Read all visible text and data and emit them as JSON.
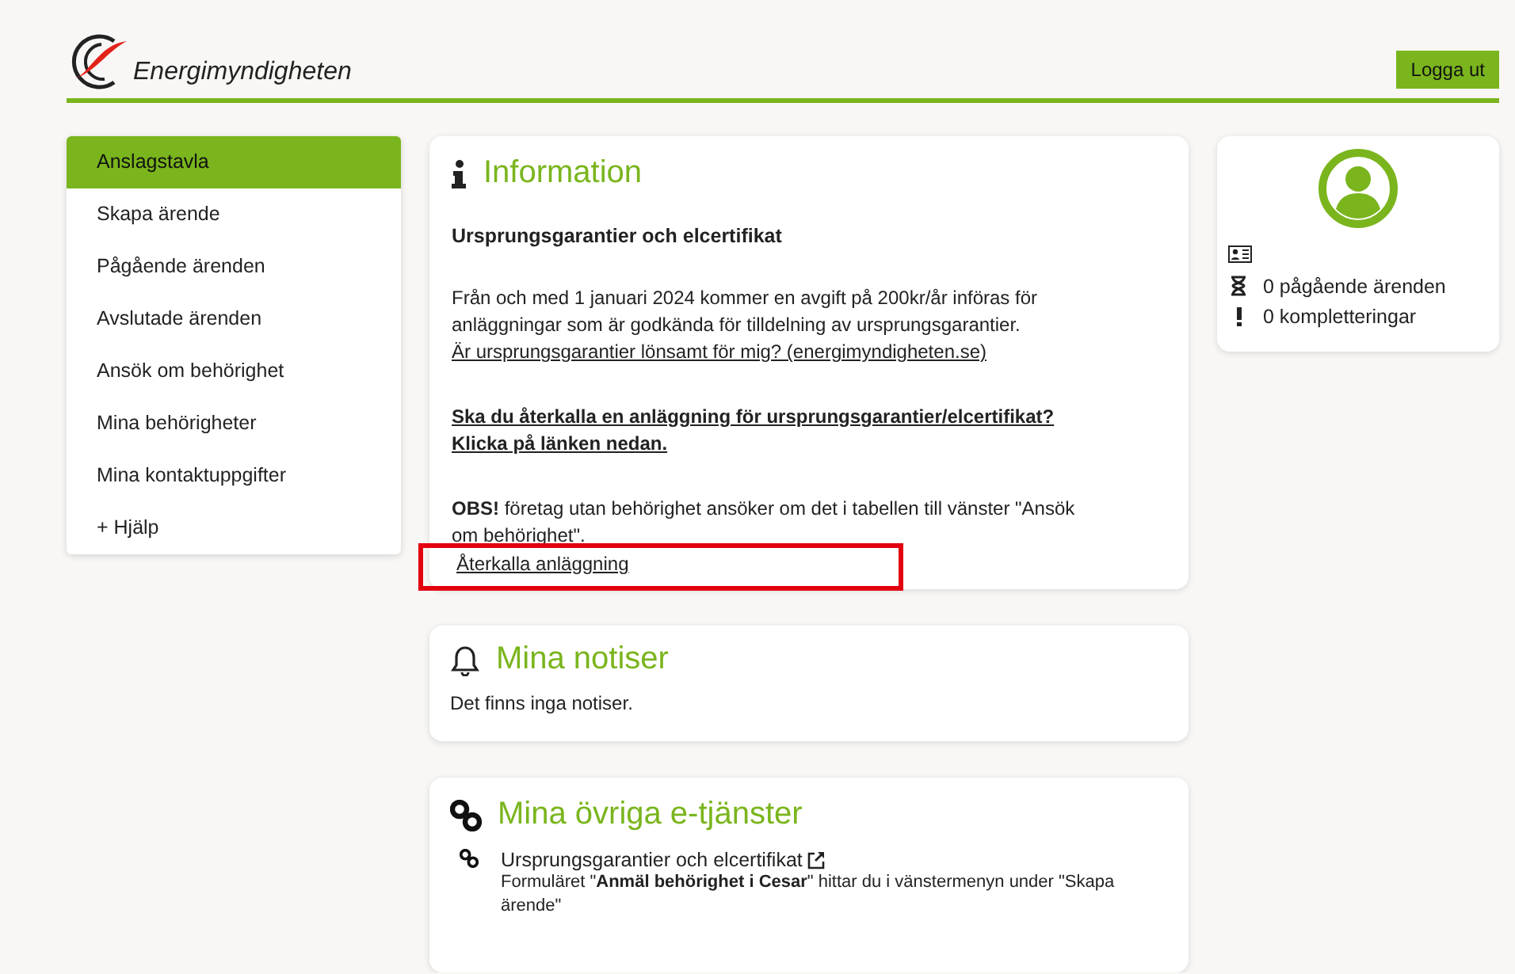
{
  "header": {
    "logo_text": "Energimyndigheten",
    "logout_button": "Logga ut"
  },
  "sidebar": {
    "items": [
      {
        "label": "Anslagstavla",
        "selected": true
      },
      {
        "label": "Skapa ärende",
        "selected": false
      },
      {
        "label": "Pågående ärenden",
        "selected": false
      },
      {
        "label": "Avslutade ärenden",
        "selected": false
      },
      {
        "label": "Ansök om behörighet",
        "selected": false
      },
      {
        "label": "Mina behörigheter",
        "selected": false
      },
      {
        "label": "Mina kontaktuppgifter",
        "selected": false
      },
      {
        "label": "+ Hjälp",
        "selected": false
      }
    ]
  },
  "information": {
    "title": "Information",
    "heading": "Ursprungsgarantier och elcertifikat",
    "paragraph": "Från och med 1 januari 2024 kommer en avgift på 200kr/år införas för anläggningar som är godkända för tilldelning av ursprungsgarantier.",
    "link": "Är ursprungsgarantier lönsamt för mig? (energimyndigheten.se)",
    "bold_link": "Ska du återkalla en anläggning för ursprungsgarantier/elcertifikat? Klicka på länken nedan.",
    "notice": "**OBS!** företag utan behörighet ansöker om det i tabellen till vänster \"Ansök om behörighet\".",
    "recall_link": {
      "label": "Återkalla anläggning",
      "highlighted": true
    }
  },
  "notifications": {
    "title": "Mina notiser",
    "message": "Det finns inga notiser."
  },
  "other_services": {
    "title": "Mina övriga e-tjänster",
    "items": [
      {
        "label": "Ursprungsgarantier och elcertifikat",
        "description": "Formuläret \"**Anmäl behörighet i Cesar**\" hittar du i vänstermenyn under \"Skapa ärende\""
      }
    ]
  },
  "profile": {
    "stats": [
      {
        "kind": "hourglass",
        "text": "0 pågående ärenden"
      },
      {
        "kind": "exclamation",
        "text": "0 kompletteringar"
      }
    ]
  }
}
